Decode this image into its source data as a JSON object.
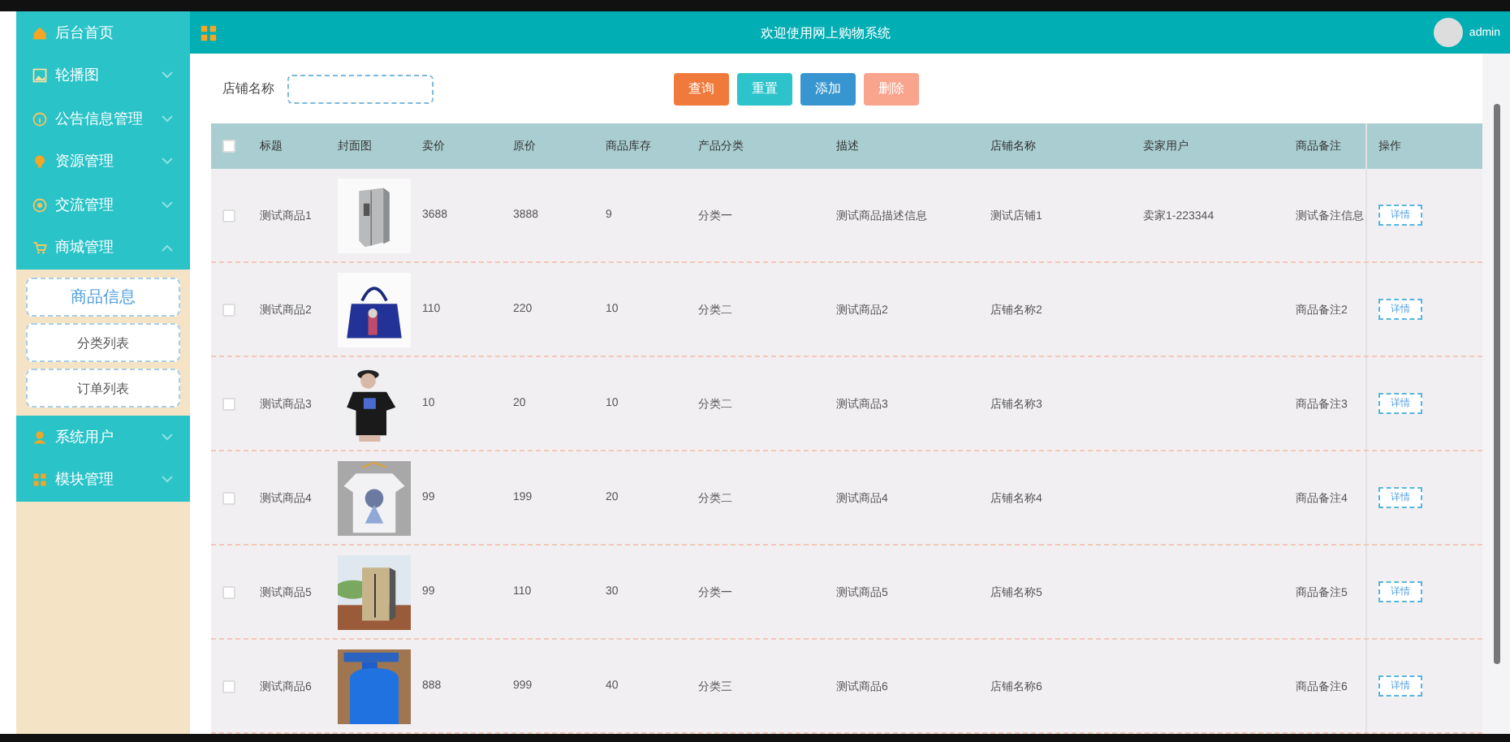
{
  "header": {
    "title": "欢迎使用网上购物系统",
    "user": "admin"
  },
  "sidebar": {
    "items": [
      {
        "label": "后台首页",
        "kind": "link"
      },
      {
        "label": "轮播图",
        "kind": "menu",
        "expanded": false
      },
      {
        "label": "公告信息管理",
        "kind": "menu",
        "expanded": false
      },
      {
        "label": "资源管理",
        "kind": "menu",
        "expanded": false
      },
      {
        "label": "交流管理",
        "kind": "menu",
        "expanded": false
      },
      {
        "label": "商城管理",
        "kind": "menu",
        "expanded": true,
        "children": [
          {
            "label": "商品信息",
            "selected": true
          },
          {
            "label": "分类列表",
            "selected": false
          },
          {
            "label": "订单列表",
            "selected": false
          }
        ]
      },
      {
        "label": "系统用户",
        "kind": "menu",
        "expanded": false
      },
      {
        "label": "模块管理",
        "kind": "menu",
        "expanded": false
      }
    ]
  },
  "search": {
    "label": "店铺名称"
  },
  "buttons": [
    {
      "label": "查询",
      "kind": "search"
    },
    {
      "label": "重置",
      "kind": "reset"
    },
    {
      "label": "添加",
      "kind": "add"
    },
    {
      "label": "删除",
      "kind": "delete"
    }
  ],
  "table": {
    "select_all_checked": false,
    "columns": [
      "标题",
      "封面图",
      "卖价",
      "原价",
      "商品库存",
      "产品分类",
      "描述",
      "店铺名称",
      "卖家用户",
      "商品备注",
      "操作"
    ],
    "rows": [
      {
        "checked": false,
        "title": "测试商品1",
        "price": "3688",
        "original_price": "3888",
        "stock": "9",
        "category": "分类一",
        "description": "测试商品描述信息",
        "shop": "测试店铺1",
        "seller": "卖家1-223344",
        "note": "测试备注信息",
        "action": "详情"
      },
      {
        "checked": false,
        "title": "测试商品2",
        "price": "110",
        "original_price": "220",
        "stock": "10",
        "category": "分类二",
        "description": "测试商品2",
        "shop": "店铺名称2",
        "note": "商品备注2",
        "action": "详情"
      },
      {
        "checked": false,
        "title": "测试商品3",
        "price": "10",
        "original_price": "20",
        "stock": "10",
        "category": "分类二",
        "description": "测试商品3",
        "shop": "店铺名称3",
        "note": "商品备注3",
        "action": "详情"
      },
      {
        "checked": false,
        "title": "测试商品4",
        "price": "99",
        "original_price": "199",
        "stock": "20",
        "category": "分类二",
        "description": "测试商品4",
        "shop": "店铺名称4",
        "note": "商品备注4",
        "action": "详情"
      },
      {
        "checked": false,
        "title": "测试商品5",
        "price": "99",
        "original_price": "110",
        "stock": "30",
        "category": "分类一",
        "description": "测试商品5",
        "shop": "店铺名称5",
        "note": "商品备注5",
        "action": "详情"
      },
      {
        "checked": false,
        "title": "测试商品6",
        "price": "888",
        "original_price": "999",
        "stock": "40",
        "category": "分类三",
        "description": "测试商品6",
        "shop": "店铺名称6",
        "note": "商品备注6",
        "action": "详情"
      }
    ]
  }
}
